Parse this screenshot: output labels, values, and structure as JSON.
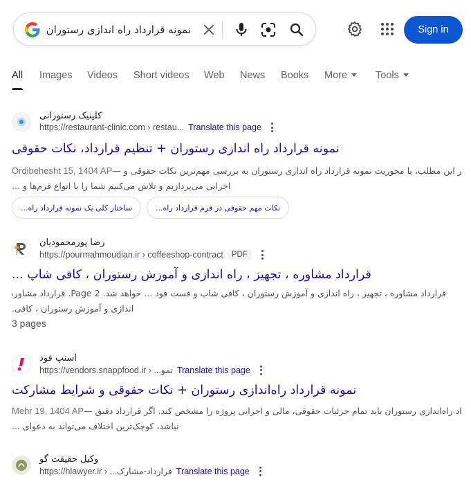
{
  "search": {
    "query": "نمونه قرارداد راه اندازی رستوران",
    "clear_icon": "close-icon",
    "mic_icon": "mic-icon",
    "lens_icon": "camera-lens-icon",
    "search_icon": "search-icon"
  },
  "header": {
    "settings_icon": "gear-icon",
    "apps_icon": "apps-grid-icon",
    "signin_label": "Sign in"
  },
  "tabs": {
    "all": "All",
    "images": "Images",
    "videos": "Videos",
    "short_videos": "Short videos",
    "web": "Web",
    "news": "News",
    "books": "Books",
    "more": "More",
    "tools": "Tools"
  },
  "results": [
    {
      "site": "کلینیک رستورانی",
      "url": "https://restaurant-clinic.com › restau...",
      "translate": "Translate this page",
      "title": "نمونه قرارداد راه اندازی رستوران + تنظیم قرارداد، نکات حقوقی",
      "date": "Ordibehesht 15, 1404 AP",
      "snippet_line1": "در این مطلب، با محوریت نمونه قرارداد راه اندازی رستوران به بررسی مهم‌ترین نکات حقوقی و —",
      "snippet_line2": "اجرایی می‌پردازیم و تلاش می‌کنیم شما را با انواع فرم‌ها و ...",
      "chips": [
        "ساختار کلی یک نمونه قرارداد راه...",
        "نکات مهم حقوقی در فرم قرارداد راه..."
      ]
    },
    {
      "site": "رضا پورمحمودیان",
      "url": "https://pourmahmoudian.ir › coffeeshop-contract",
      "badge": "PDF",
      "title": "قرارداد مشاوره ، تجهیز ، راه اندازی و آموزش رستوران ، کافی شاپ ...",
      "snippet_line1": "قرارداد مشاوره ، تجهیز ، راه اندازی و آموزش رستوران ، کافی شاپ و فست فود ... خواهد شد. Page 2. قرارداد مشاوره ، تجهیز ، راه",
      "snippet_line2": "اندازی و آموزش رستوران ، کافی.",
      "pages": "3 pages"
    },
    {
      "site": "اسنپ فود",
      "url": "https://vendors.snappfood.ir › ...نمو",
      "translate": "Translate this page",
      "title": "نمونه قرارداد راه‌اندازی رستوران + نکات حقوقی و شرایط مشارکت",
      "date": "Mehr 19, 1404 AP",
      "snippet_line1": "یک نمونه قرارداد راه‌اندازی رستوران باید تمام جزئیات حقوقی، مالی و اجرایی پروژه را مشخص کند. اگر قرارداد دقیق —",
      "snippet_line2": "نباشد، کوچک‌ترین اختلاف می‌تواند به دعوای ..."
    },
    {
      "site": "وکیل حقیقت گو",
      "url": "https://hlawyer.ir › ...قرارداد-مشارک",
      "translate": "Translate this page"
    }
  ],
  "colors": {
    "link": "#1a0dab",
    "signin_bg": "#0b57d0",
    "snapp_pink": "#ec0b6e",
    "reza_orange": "#f7941d"
  }
}
